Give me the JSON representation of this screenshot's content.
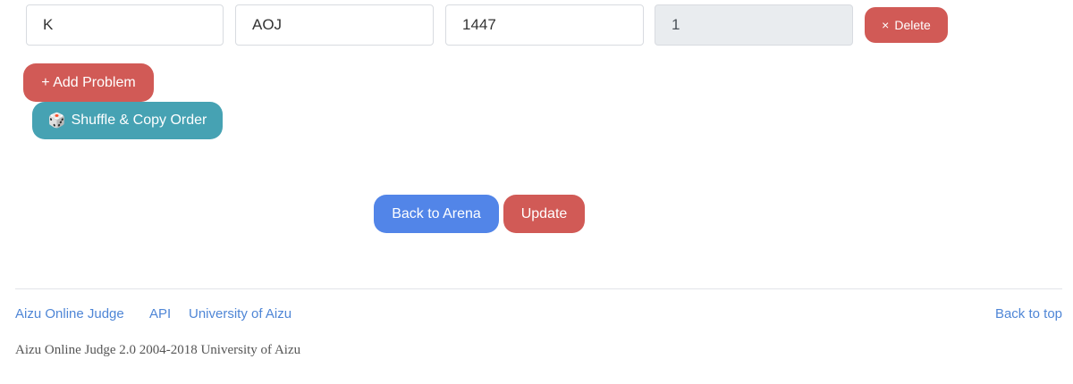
{
  "problem_row": {
    "label_value": "K",
    "source_value": "AOJ",
    "problem_id_value": "1447",
    "order_value": "1",
    "delete_label": "Delete",
    "delete_icon": "×"
  },
  "actions": {
    "add_problem_label": "+ Add Problem",
    "shuffle_label": "Shuffle & Copy Order",
    "shuffle_icon": "🎲",
    "back_label": "Back to Arena",
    "update_label": "Update"
  },
  "footer": {
    "links": [
      "Aizu Online Judge",
      "API",
      "University of Aizu"
    ],
    "back_to_top": "Back to top",
    "copyright": "Aizu Online Judge 2.0 2004-2018 University of Aizu"
  },
  "colors": {
    "danger": "#d15a56",
    "info": "#46a2b3",
    "primary": "#5285e8",
    "link": "#4f86d6"
  }
}
